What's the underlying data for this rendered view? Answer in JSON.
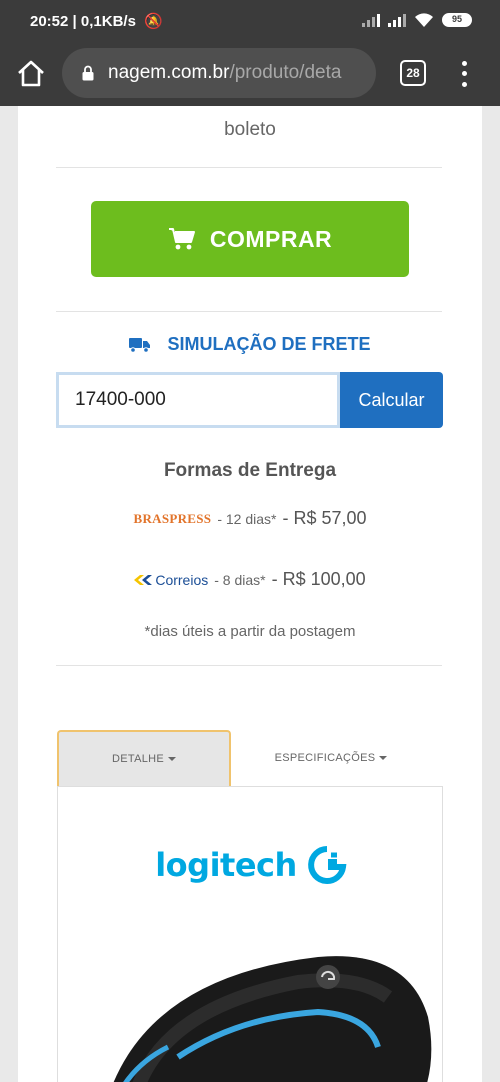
{
  "status_bar": {
    "time": "20:52",
    "network_speed": "| 0,1KB/s",
    "battery": "95"
  },
  "browser": {
    "url_host": "nagem.com.br",
    "url_path": "/produto/deta",
    "tab_count": "28"
  },
  "product": {
    "price_payment_note": "boleto",
    "buy_label": "COMPRAR"
  },
  "shipping": {
    "title": "SIMULAÇÃO DE FRETE",
    "cep_value": "17400-000",
    "calc_label": "Calcular",
    "delivery_title": "Formas de Entrega",
    "options": [
      {
        "carrier": "BRASPRESS",
        "days": "- 12 dias*",
        "price": "- R$ 57,00"
      },
      {
        "carrier": "Correios",
        "days": "- 8 dias*",
        "price": "- R$ 100,00"
      }
    ],
    "note": "*dias úteis a partir da postagem"
  },
  "tabs": [
    {
      "label": "DETALHE"
    },
    {
      "label": "ESPECIFICAÇÕES"
    }
  ],
  "detail": {
    "brand": "logitech"
  },
  "colors": {
    "accent_green": "#6dbd1e",
    "accent_blue": "#1f6fc0",
    "logitech_blue": "#00a8e1"
  }
}
